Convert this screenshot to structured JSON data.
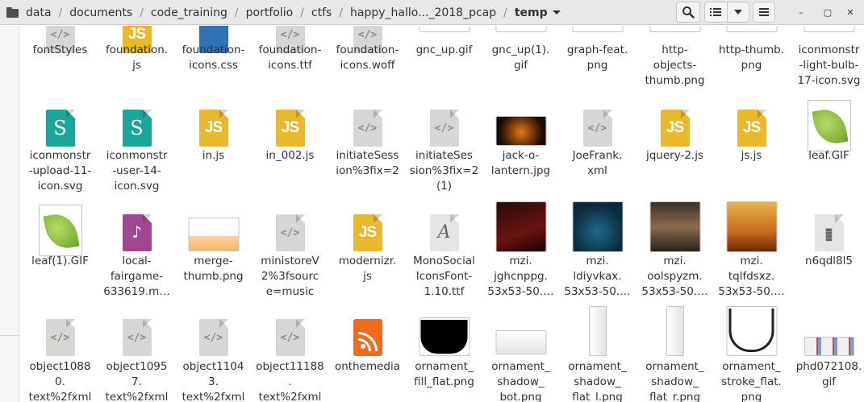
{
  "breadcrumbs": [
    "data",
    "documents",
    "code_training",
    "portfolio",
    "ctfs",
    "happy_hallo..._2018_pcap"
  ],
  "current_folder": "temp",
  "icons": {
    "home": "home-icon",
    "search": "search-icon",
    "list_view": "list-view-icon",
    "view_options": "chevron-down-icon",
    "menu": "hamburger-menu-icon",
    "minimize": "minimize-icon",
    "maximize": "maximize-icon",
    "close": "close-icon"
  },
  "window_controls": {
    "minimize": "–",
    "maximize": "▢",
    "close": "✕"
  },
  "rows": [
    [
      "fontStyles",
      "foundation.js",
      "foundation-icons.css",
      "foundation-icons.ttf",
      "foundation-icons.woff",
      "gnc_up.gif",
      "gnc_up(1).gif",
      "graph-feat.png",
      "http-objects-thumb.png",
      "http-thumb.png",
      "iconmonstr-light-bulb-17-icon.svg"
    ],
    [
      "iconmonstr-upload-11-icon.svg",
      "iconmonstr-user-14-icon.svg",
      "in.js",
      "in_002.js",
      "initiateSession%3fix=2",
      "initiateSession%3fix=2(1)",
      "jack-o-lantern.jpg",
      "JoeFrank.xml",
      "jquery-2.js",
      "js.js",
      "leaf.GIF"
    ],
    [
      "leaf(1).GIF",
      "local-fairgame-633619.m…",
      "merge-thumb.png",
      "ministoreV2%3fsource=music",
      "modernizr.js",
      "MonoSocialIconsFont-1.10.ttf",
      "mzi.jghcnppg.53x53-50.…",
      "mzi.ldiyvkax.53x53-50.…",
      "mzi.oolspyzm.53x53-50.…",
      "mzi.tqlfdsxz.53x53-50.…",
      "n6qdl8l5"
    ],
    [
      "object10880.text%2fxml",
      "object10957.text%2fxml",
      "object11043.text%2fxml",
      "object11188.text%2fxml",
      "onthemedia",
      "ornament_fill_flat.png",
      "ornament_shadow_bot.png",
      "ornament_shadow_flat_l.png",
      "ornament_shadow_flat_r.png",
      "ornament_stroke_flat.png",
      "phd072108.gif"
    ]
  ],
  "display_labels": [
    [
      [
        "fontStyles"
      ],
      [
        "foundation.",
        "js"
      ],
      [
        "foundation-",
        "icons.css"
      ],
      [
        "foundation-",
        "icons.ttf"
      ],
      [
        "foundation-",
        "icons.woff"
      ],
      [
        "gnc_up.gif"
      ],
      [
        "gnc_up(1).",
        "gif"
      ],
      [
        "graph-feat.",
        "png"
      ],
      [
        "http-",
        "objects-",
        "thumb.png"
      ],
      [
        "http-thumb.",
        "png"
      ],
      [
        "iconmonstr",
        "-light-bulb-",
        "17-icon.svg"
      ]
    ],
    [
      [
        "iconmonstr",
        "-upload-11-",
        "icon.svg"
      ],
      [
        "iconmonstr",
        "-user-14-",
        "icon.svg"
      ],
      [
        "in.js"
      ],
      [
        "in_002.js"
      ],
      [
        "initiateSess",
        "ion%3fix=2"
      ],
      [
        "initiateSes",
        "sion%3fix=2",
        "(1)"
      ],
      [
        "jack-o-",
        "lantern.jpg"
      ],
      [
        "JoeFrank.",
        "xml"
      ],
      [
        "jquery-2.js"
      ],
      [
        "js.js"
      ],
      [
        "leaf.GIF"
      ]
    ],
    [
      [
        "leaf(1).GIF"
      ],
      [
        "local-",
        "fairgame-",
        "633619.m…"
      ],
      [
        "merge-",
        "thumb.png"
      ],
      [
        "ministoreV",
        "2%3fsourc",
        "e=music"
      ],
      [
        "modernizr.",
        "js"
      ],
      [
        "MonoSocial",
        "IconsFont-",
        "1.10.ttf"
      ],
      [
        "mzi.",
        "jghcnppg.",
        "53x53-50.…"
      ],
      [
        "mzi.",
        "ldiyvkax.",
        "53x53-50.…"
      ],
      [
        "mzi.",
        "oolspyzm.",
        "53x53-50.…"
      ],
      [
        "mzi.",
        "tqlfdsxz.",
        "53x53-50.…"
      ],
      [
        "n6qdl8l5"
      ]
    ],
    [
      [
        "object1088",
        "0.",
        "text%2fxml"
      ],
      [
        "object1095",
        "7.",
        "text%2fxml"
      ],
      [
        "object1104",
        "3.",
        "text%2fxml"
      ],
      [
        "object11188",
        ".",
        "text%2fxml"
      ],
      [
        "onthemedia"
      ],
      [
        "ornament_",
        "fill_flat.png"
      ],
      [
        "ornament_",
        "shadow_",
        "bot.png"
      ],
      [
        "ornament_",
        "shadow_",
        "flat_l.png"
      ],
      [
        "ornament_",
        "shadow_",
        "flat_r.png"
      ],
      [
        "ornament_",
        "stroke_flat.",
        "png"
      ],
      [
        "phd072108.",
        "gif"
      ]
    ]
  ],
  "colors": {
    "header_bg": "#e8e8e7",
    "js_icon": "#e9b82c",
    "svg_icon": "#1aa79a",
    "audio_icon": "#a0478f",
    "rss_icon": "#f26a1b"
  }
}
